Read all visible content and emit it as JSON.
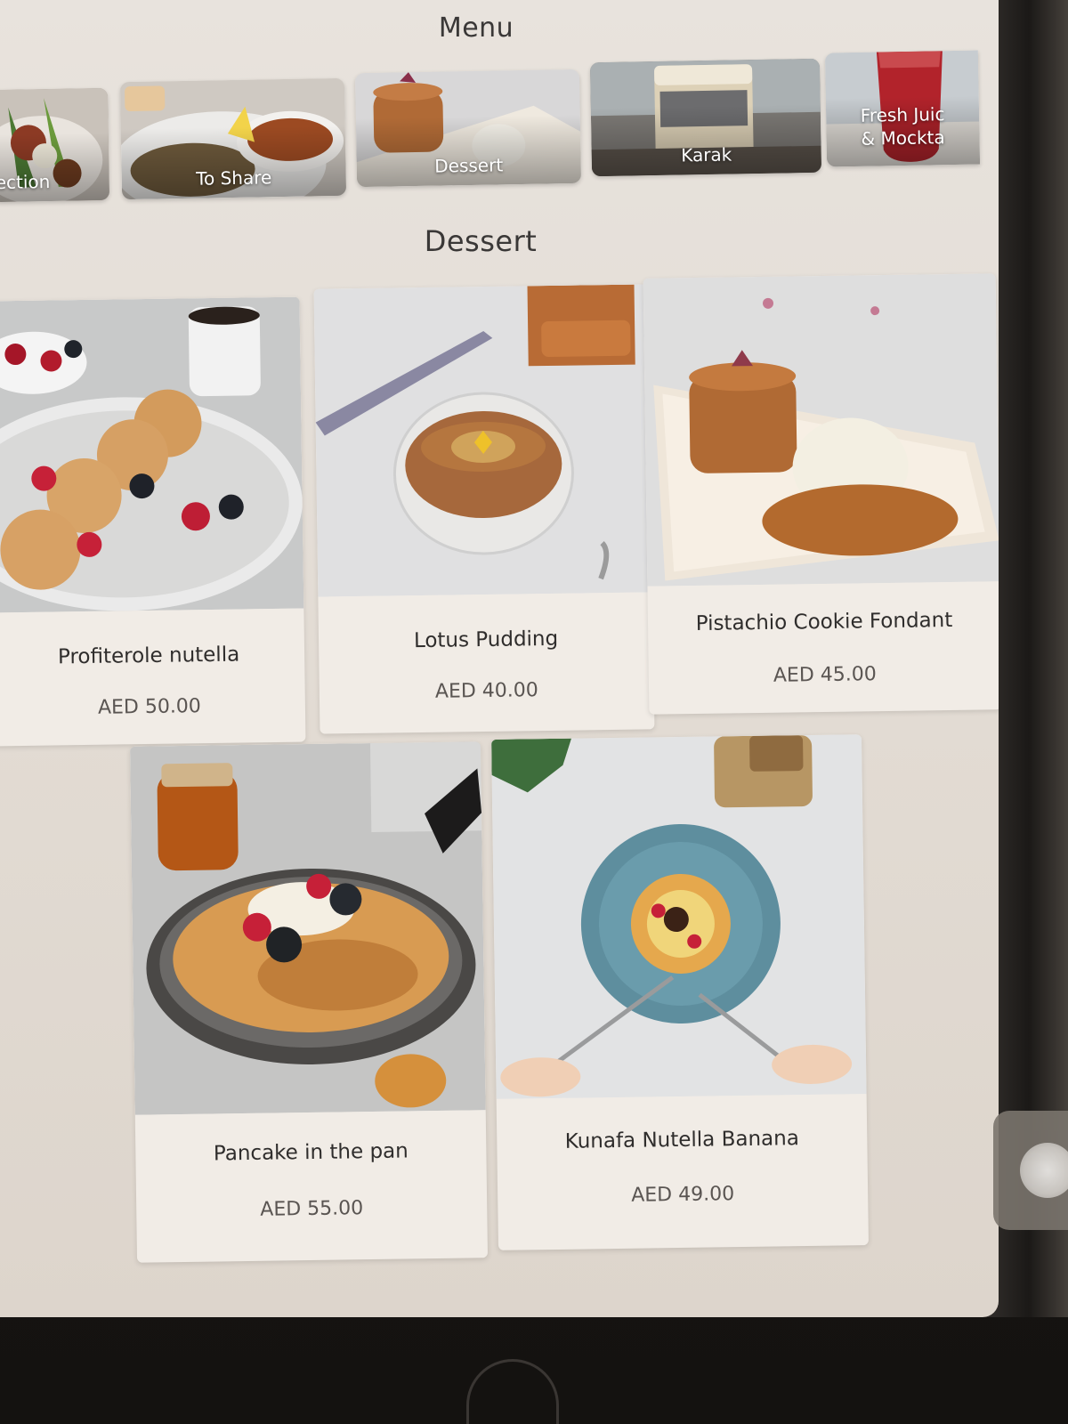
{
  "header": {
    "title": "Menu"
  },
  "categories": [
    {
      "label": "ection",
      "image": "selection-plate-photo"
    },
    {
      "label": "To Share",
      "image": "to-share-platter-photo"
    },
    {
      "label": "Dessert",
      "image": "dessert-cake-photo"
    },
    {
      "label": "Karak",
      "image": "karak-jar-photo"
    },
    {
      "label": "Fresh Juic\n& Mockta",
      "image": "fresh-juice-glass-photo"
    }
  ],
  "section": {
    "title": "Dessert"
  },
  "products": [
    {
      "name": "Profiterole nutella",
      "price": "AED 50.00",
      "image": "profiterole-photo"
    },
    {
      "name": "Lotus Pudding",
      "price": "AED 40.00",
      "image": "lotus-pudding-photo"
    },
    {
      "name": "Pistachio Cookie Fondant",
      "price": "AED 45.00",
      "image": "pistachio-fondant-photo"
    },
    {
      "name": "Pancake in the pan",
      "price": "AED 55.00",
      "image": "pancake-pan-photo"
    },
    {
      "name": "Kunafa Nutella Banana",
      "price": "AED 49.00",
      "image": "kunafa-banana-photo"
    }
  ],
  "colors": {
    "screen_bg": "#e5dfd8",
    "card_bg": "#f1ece6",
    "text_dark": "#2f2d2c",
    "price_text": "#5a5552"
  }
}
